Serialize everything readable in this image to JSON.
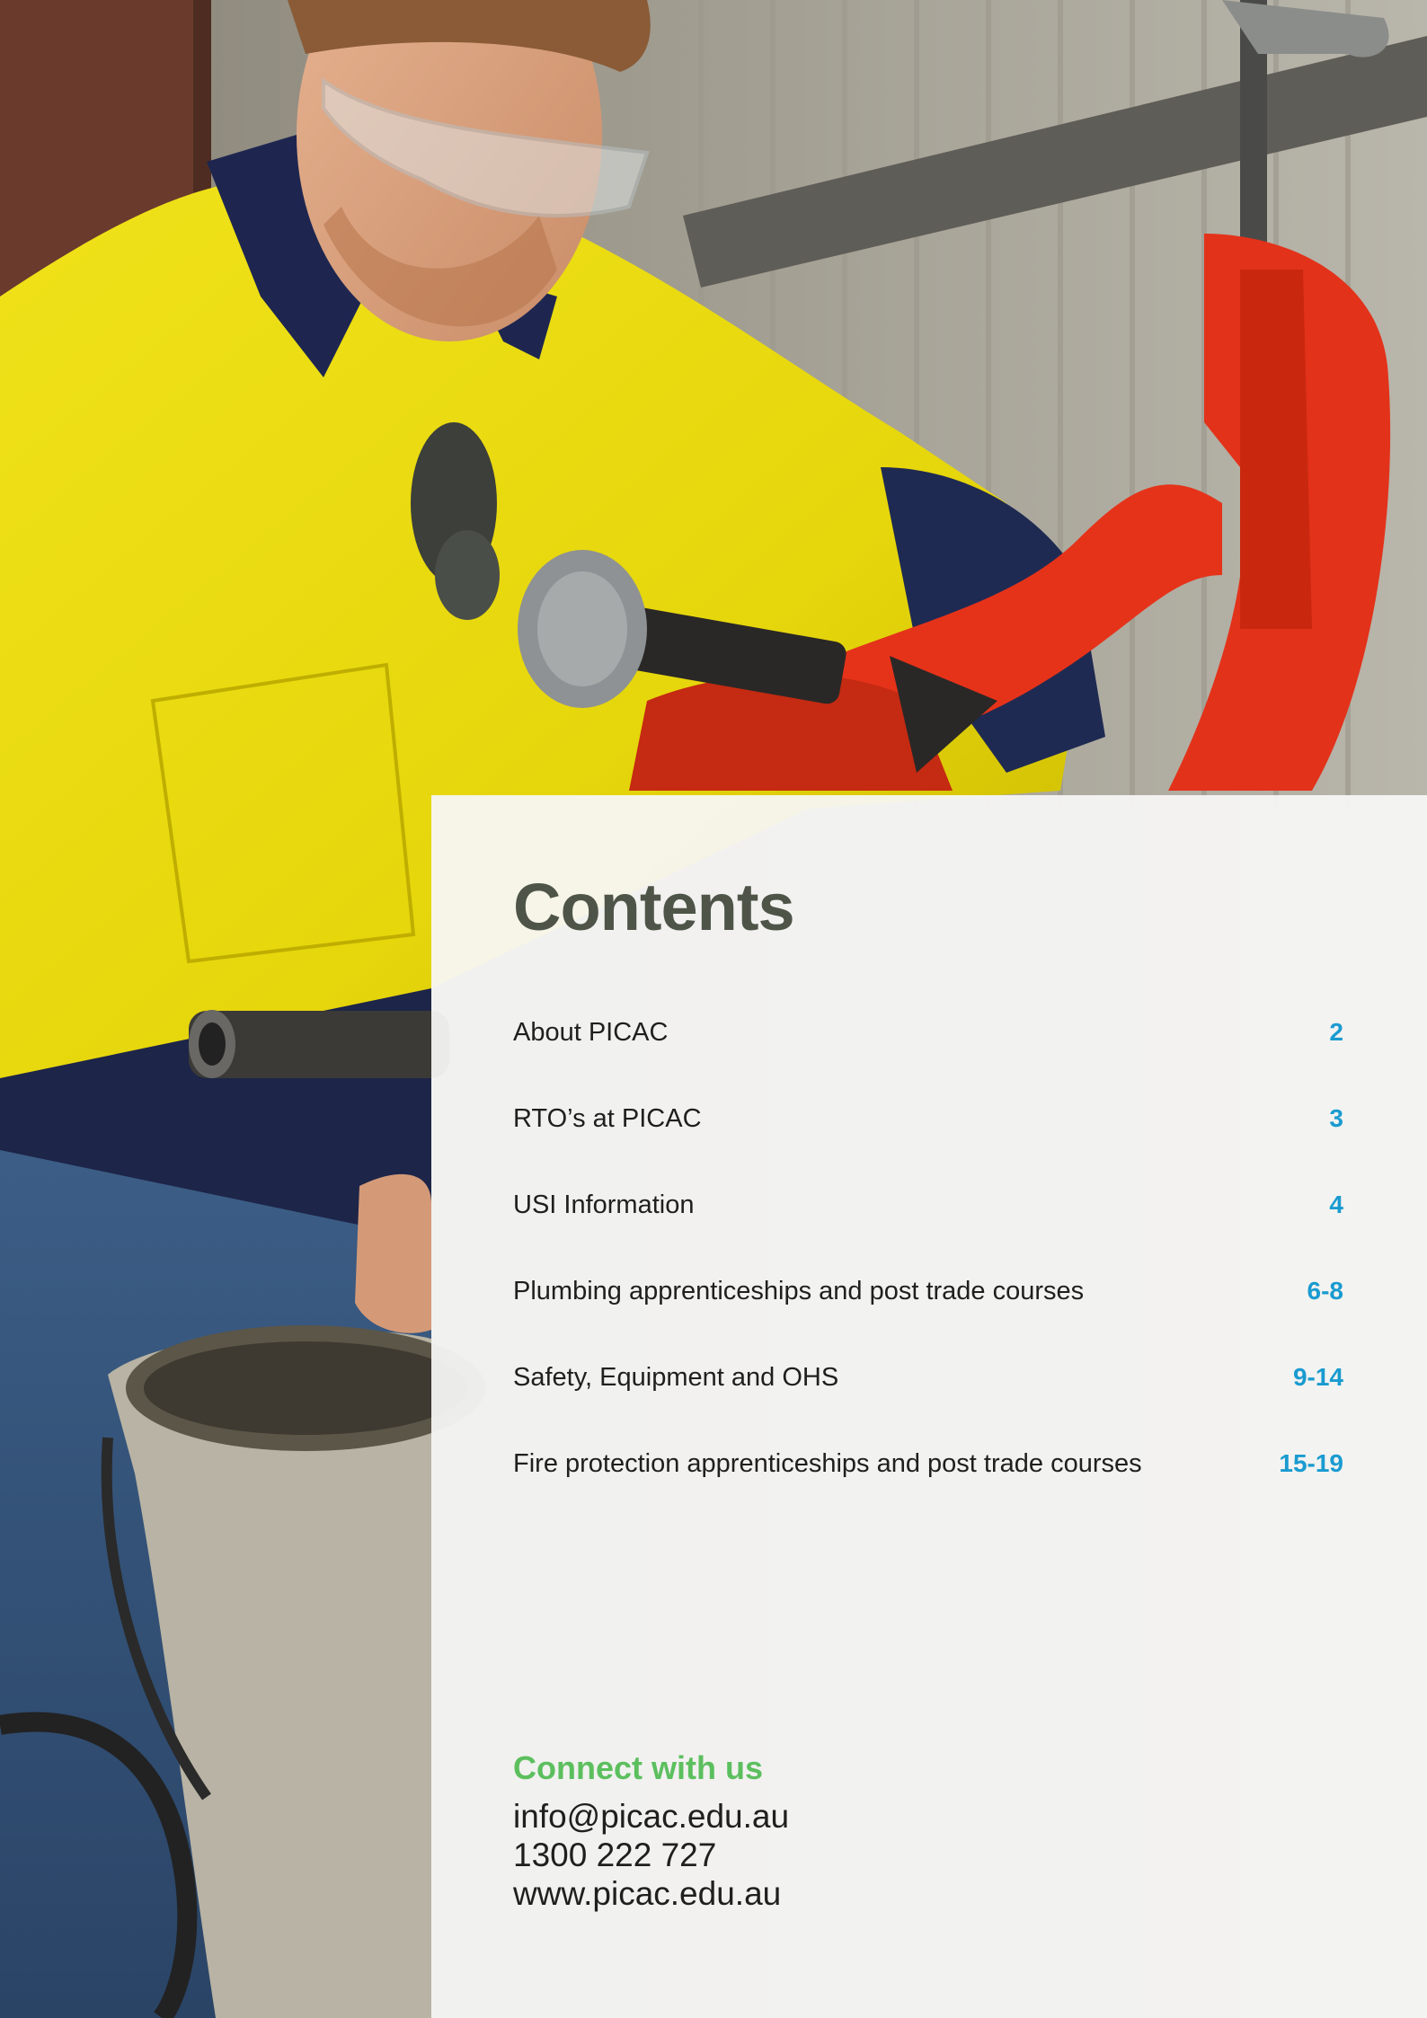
{
  "colors": {
    "title": "#4e5548",
    "page_number": "#1a9bd0",
    "connect_heading": "#5cbf5e",
    "body_text": "#1f1f1f",
    "panel_background": "#f6f6f5"
  },
  "photo": {
    "icon": "worker-photo",
    "subject": "Apprentice in hi-vis shirt operating a red pipe threading machine"
  },
  "contents": {
    "title": "Contents",
    "entries": [
      {
        "label": "About PICAC",
        "page": "2"
      },
      {
        "label": "RTO’s at PICAC",
        "page": "3"
      },
      {
        "label": "USI Information",
        "page": "4"
      },
      {
        "label": "Plumbing apprenticeships and post trade courses",
        "page": "6-8"
      },
      {
        "label": "Safety, Equipment and OHS",
        "page": "9-14"
      },
      {
        "label": "Fire protection apprenticeships and post trade courses",
        "page": "15-19"
      }
    ]
  },
  "connect": {
    "title": "Connect with us",
    "email": "info@picac.edu.au",
    "phone": "1300 222 727",
    "website": "www.picac.edu.au"
  }
}
